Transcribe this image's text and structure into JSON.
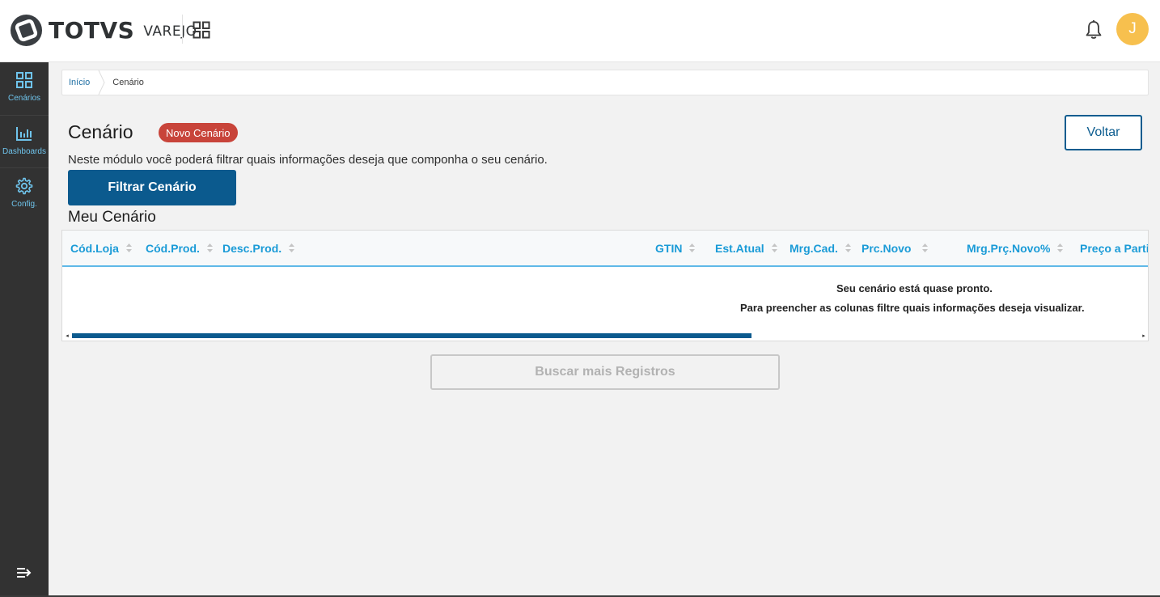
{
  "header": {
    "brand": "TOTVS",
    "product": "VAREJO",
    "avatar_initial": "J"
  },
  "sidebar": {
    "items": [
      {
        "label": "Cenários",
        "icon": "grid-icon"
      },
      {
        "label": "Dashboards",
        "icon": "bar-chart-icon"
      },
      {
        "label": "Config.",
        "icon": "gear-icon"
      }
    ]
  },
  "breadcrumb": {
    "items": [
      "Início",
      "Cenário"
    ]
  },
  "page": {
    "title": "Cenário",
    "badge": "Novo Cenário",
    "back_label": "Voltar",
    "description": "Neste módulo você poderá filtrar quais informações deseja que componha o seu cenário.",
    "filter_button": "Filtrar Cenário",
    "section_title": "Meu Cenário",
    "load_more": "Buscar mais Registros"
  },
  "table": {
    "columns": [
      "Cód.Loja",
      "Cód.Prod.",
      "Desc.Prod.",
      "GTIN",
      "Est.Atual",
      "Mrg.Cad.",
      "Prc.Novo",
      "Mrg.Prç.Novo%",
      "Preço a Parti"
    ],
    "empty_title": "Seu cenário está quase pronto.",
    "empty_text": "Para preencher as colunas filtre quais informações deseja visualizar."
  },
  "colors": {
    "primary": "#0b5a8e",
    "accent": "#1a9bd7",
    "badge": "#c8443a",
    "sidebar": "#323232",
    "avatar": "#f7c04e"
  }
}
